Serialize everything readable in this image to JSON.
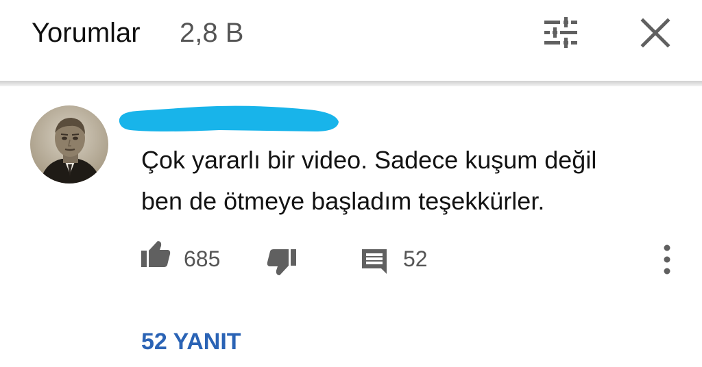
{
  "header": {
    "title": "Yorumlar",
    "count": "2,8 B",
    "icons": {
      "filter": "sort-sliders-icon",
      "close": "close-icon"
    }
  },
  "comment": {
    "author_redacted": true,
    "text_lines": [
      "Çok yararlı bir video. Sadece kuşum değil",
      "ben de ötmeye başladım teşekkürler."
    ],
    "likes": "685",
    "reply_count": "52",
    "replies_link": "52 YANIT"
  },
  "colors": {
    "redaction": "#18b4ea",
    "link": "#2a63b5",
    "icon": "#606060"
  }
}
